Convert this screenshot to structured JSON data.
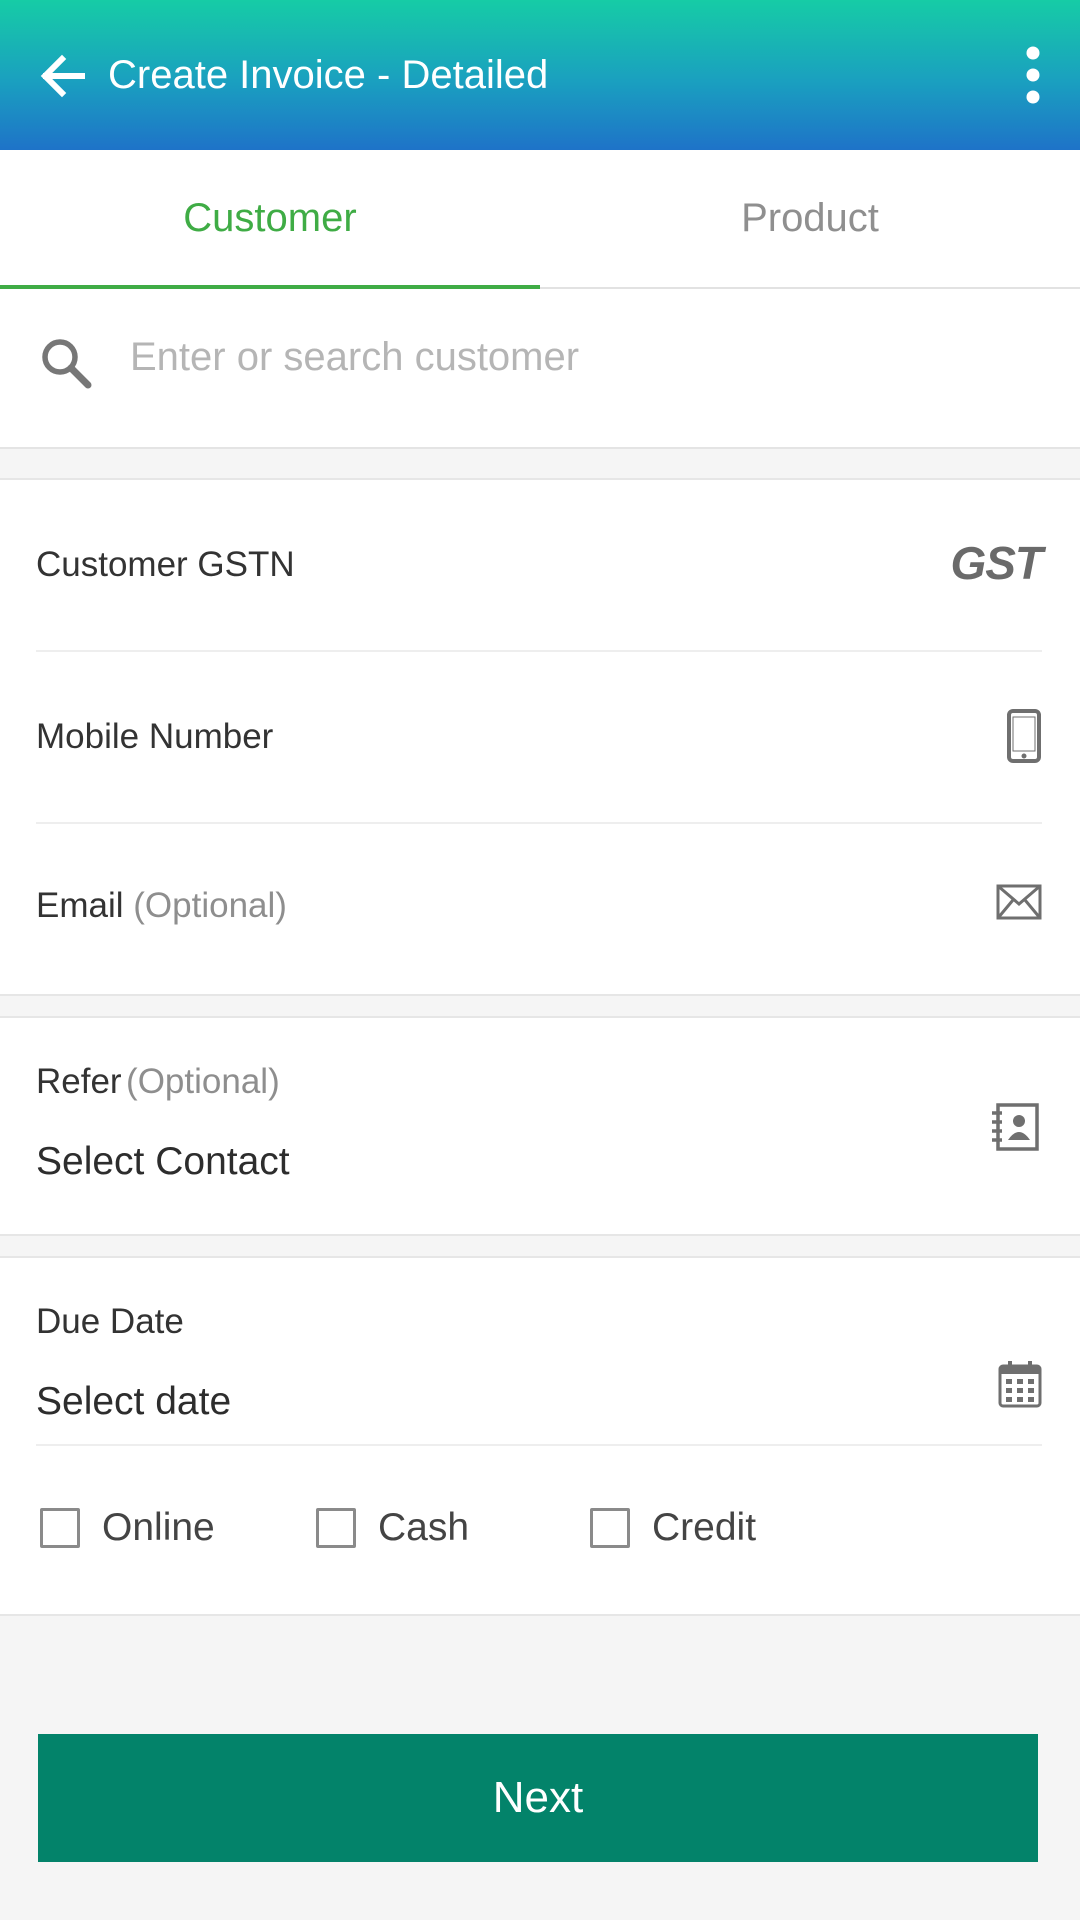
{
  "appbar": {
    "title": "Create Invoice - Detailed",
    "back_icon": "arrow-left-icon",
    "menu_icon": "more-vertical-icon",
    "gradient_colors": [
      "#16cca6",
      "#1e73c8"
    ]
  },
  "tabs": [
    {
      "label": "Customer",
      "active": true
    },
    {
      "label": "Product",
      "active": false
    }
  ],
  "search": {
    "placeholder": "Enter or search customer",
    "icon": "search-icon"
  },
  "fields": {
    "gstn": {
      "label": "Customer GSTN",
      "icon_text": "GST",
      "icon": "gst-icon"
    },
    "mobile": {
      "label": "Mobile Number",
      "icon": "mobile-phone-icon"
    },
    "email": {
      "label": "Email",
      "optional": "(Optional)",
      "icon": "envelope-icon"
    },
    "refer": {
      "label": "Refer",
      "optional": "(Optional)",
      "value": "Select Contact",
      "icon": "contact-book-icon"
    },
    "due_date": {
      "label": "Due Date",
      "value": "Select date",
      "icon": "calendar-icon"
    }
  },
  "payment_options": [
    {
      "label": "Online",
      "checked": false
    },
    {
      "label": "Cash",
      "checked": false
    },
    {
      "label": "Credit",
      "checked": false
    }
  ],
  "next_button": {
    "label": "Next"
  },
  "colors": {
    "accent_green": "#3fac45",
    "button_teal": "#03836a"
  }
}
